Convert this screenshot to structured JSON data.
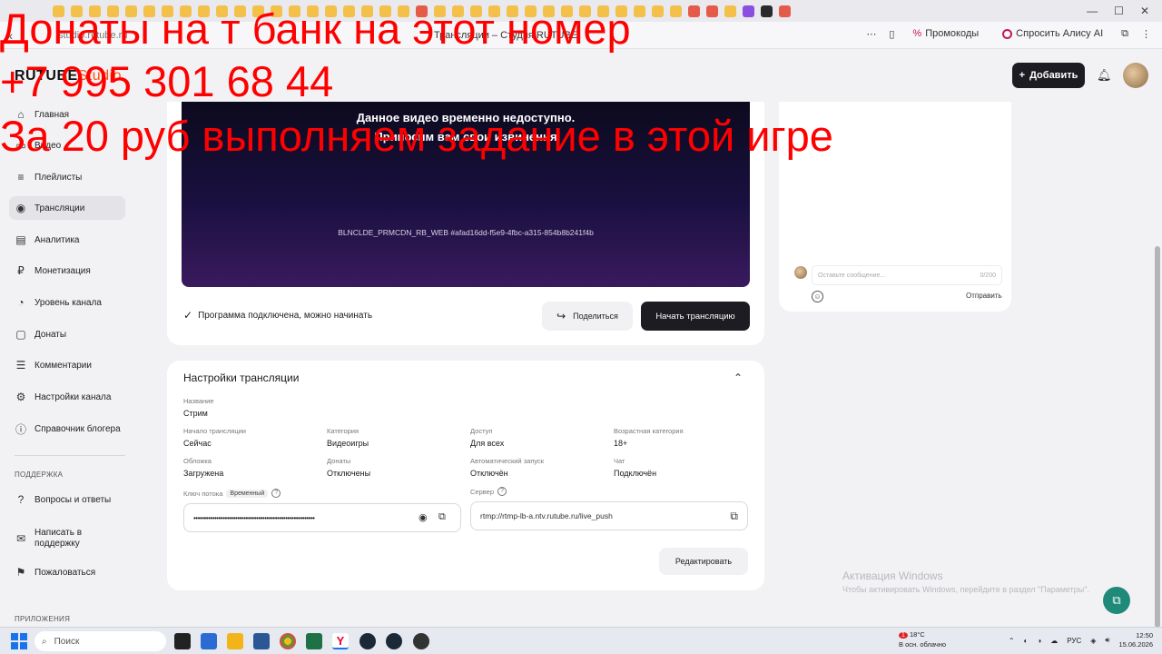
{
  "overlay": {
    "line1": "Донаты на т банк на этот номер",
    "line2": "+7 995 301 68 44",
    "line3": "За 20 руб выполняем задание в этой игре",
    "color": "#ff0000"
  },
  "browser": {
    "page_title": "Трансляции – Студия RUTUBE",
    "url": "studio.rutube.ru",
    "promo_label": "Промокоды",
    "alice_label": "Спросить Алису AI"
  },
  "header": {
    "logo_main": "RUTUBE",
    "logo_studio": "Studio",
    "add_button": "Добавить"
  },
  "sidebar": {
    "items": [
      {
        "label": "Главная",
        "icon": "home-icon"
      },
      {
        "label": "Видео",
        "icon": "video-icon"
      },
      {
        "label": "Плейлисты",
        "icon": "playlist-icon"
      },
      {
        "label": "Трансляции",
        "icon": "broadcast-icon"
      },
      {
        "label": "Аналитика",
        "icon": "analytics-icon"
      },
      {
        "label": "Монетизация",
        "icon": "ruble-icon"
      },
      {
        "label": "Уровень канала",
        "icon": "level-icon"
      },
      {
        "label": "Донаты",
        "icon": "donate-icon"
      },
      {
        "label": "Комментарии",
        "icon": "comment-icon"
      },
      {
        "label": "Настройки канала",
        "icon": "gear-icon"
      },
      {
        "label": "Справочник блогера",
        "icon": "info-icon"
      }
    ],
    "support_section": "ПОДДЕРЖКА",
    "support_items": [
      {
        "label": "Вопросы и ответы",
        "icon": "help-icon"
      },
      {
        "label": "Написать в поддержку",
        "icon": "mail-icon"
      },
      {
        "label": "Пожаловаться",
        "icon": "flag-icon"
      }
    ],
    "apps_section": "ПРИЛОЖЕНИЯ"
  },
  "player": {
    "message_line1": "Данное видео временно недоступно.",
    "message_line2": "Приносим вам свои извинения",
    "error_code": "BLNCLDE_PRMCDN_RB_WEB #afad16dd-f5e9-4fbc-a315-854b8b241f4b"
  },
  "stream_status": {
    "text": "Программа подключена, можно начинать",
    "share_button": "Поделиться",
    "start_button": "Начать трансляцию"
  },
  "chat": {
    "placeholder": "Оставьте сообщение...",
    "counter": "0/200",
    "send_button": "Отправить"
  },
  "settings": {
    "title": "Настройки трансляции",
    "name_label": "Название",
    "name_value": "Стрим",
    "fields": [
      {
        "label": "Начало трансляции",
        "value": "Сейчас"
      },
      {
        "label": "Категория",
        "value": "Видеоигры"
      },
      {
        "label": "Доступ",
        "value": "Для всех"
      },
      {
        "label": "Возрастная категория",
        "value": "18+"
      },
      {
        "label": "Обложка",
        "value": "Загружена"
      },
      {
        "label": "Донаты",
        "value": "Отключены"
      },
      {
        "label": "Автоматический запуск",
        "value": "Отключён"
      },
      {
        "label": "Чат",
        "value": "Подключён"
      }
    ],
    "key_label": "Ключ потока",
    "key_tag": "Временный",
    "key_value": "••••••••••••••••••••••••••••••••••••••••••••••••••••••••••",
    "server_label": "Сервер",
    "server_value": "rtmp://rtmp-lb-a.ntv.rutube.ru/live_push",
    "edit_button": "Редактировать"
  },
  "watermark": {
    "line1": "Активация Windows",
    "line2": "Чтобы активировать Windows, перейдите в раздел \"Параметры\"."
  },
  "taskbar": {
    "search_placeholder": "Поиск",
    "weather_temp": "18°C",
    "weather_desc": "В осн. облачно",
    "language": "РУС",
    "time": "12:50",
    "date": "15.06.2026",
    "notification_count": "1"
  }
}
